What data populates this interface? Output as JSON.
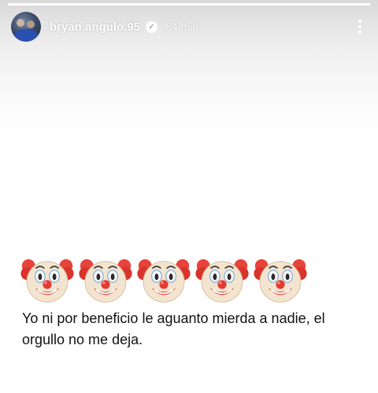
{
  "story": {
    "username": "bryan.angulo.95",
    "time_ago": "54 min",
    "progress": [
      1
    ],
    "emojis": [
      "🤡",
      "🤡",
      "🤡",
      "🤡",
      "🤡"
    ],
    "caption": "Yo ni por beneficio le aguanto mierda a nadie, el orgullo no me deja."
  },
  "icons": {
    "verified": "verified-badge-icon",
    "more": "more-options-icon",
    "emoji": "clown-face-emoji"
  },
  "colors": {
    "header_text": "#ffffff",
    "caption_text": "#111111",
    "background": "#ffffff"
  }
}
